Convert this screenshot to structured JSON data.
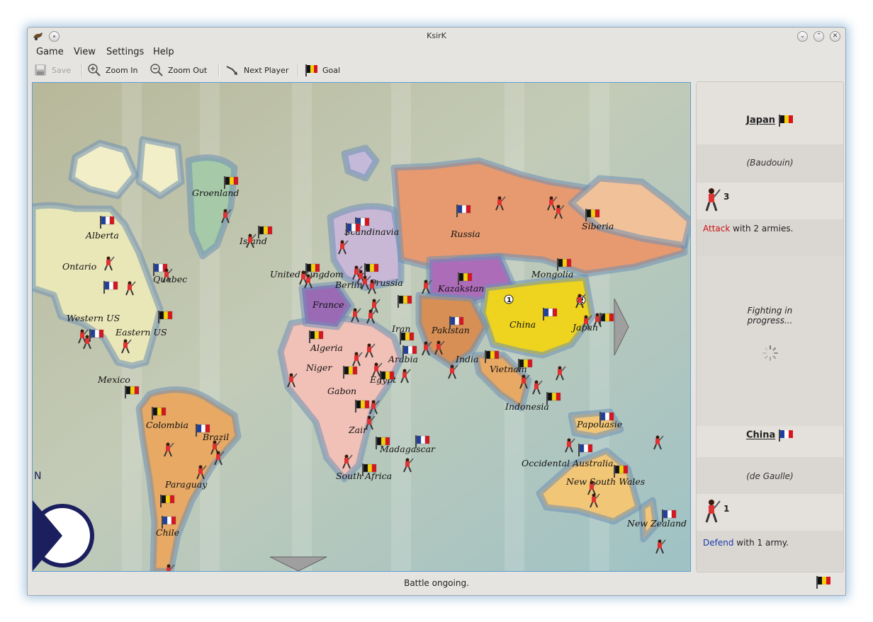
{
  "window": {
    "title": "KsirK"
  },
  "menu": [
    "Game",
    "View",
    "Settings",
    "Help"
  ],
  "toolbar": {
    "save": "Save",
    "zoom_in": "Zoom In",
    "zoom_out": "Zoom Out",
    "next_player": "Next Player",
    "goal": "Goal"
  },
  "map": {
    "countries": [
      "Groenland",
      "Alberta",
      "Island",
      "Scandinavia",
      "Russia",
      "Siberia",
      "Ontario",
      "Quebec",
      "United Kingdom",
      "Berlin",
      "Prussia",
      "Kazakstan",
      "Mongolia",
      "France",
      "Western US",
      "Eastern US",
      "Iran",
      "Pakistan",
      "China",
      "Japan",
      "Algeria",
      "Arabia",
      "Niger",
      "Egypt",
      "India",
      "Vietnam",
      "Mexico",
      "Gabon",
      "Indonesia",
      "Colombia",
      "Brazil",
      "Papouasie",
      "Zair",
      "Madagascar",
      "Occidental Australia",
      "New South Wales",
      "South Africa",
      "Paraguay",
      "Chile",
      "New Zealand"
    ],
    "compass_letter": "N",
    "markers": [
      "1",
      "2"
    ]
  },
  "attacker": {
    "nation": "Japan",
    "leader": "(Baudouin)",
    "armies": "3",
    "action_word": "Attack",
    "action_rest": " with 2 armies."
  },
  "fight": {
    "status": "Fighting in progress..."
  },
  "defender": {
    "nation": "China",
    "leader": "(de Gaulle)",
    "armies": "1",
    "action_word": "Defend",
    "action_rest": " with 1 army."
  },
  "status": {
    "text": "Battle ongoing."
  },
  "colors": {
    "belgium": [
      "#111111",
      "#f3d20c",
      "#d8141f"
    ],
    "france": [
      "#1f3fa0",
      "#ffffff",
      "#d8141f"
    ],
    "ocean": "#b7c4a8",
    "accent": "#5f9ecf"
  }
}
